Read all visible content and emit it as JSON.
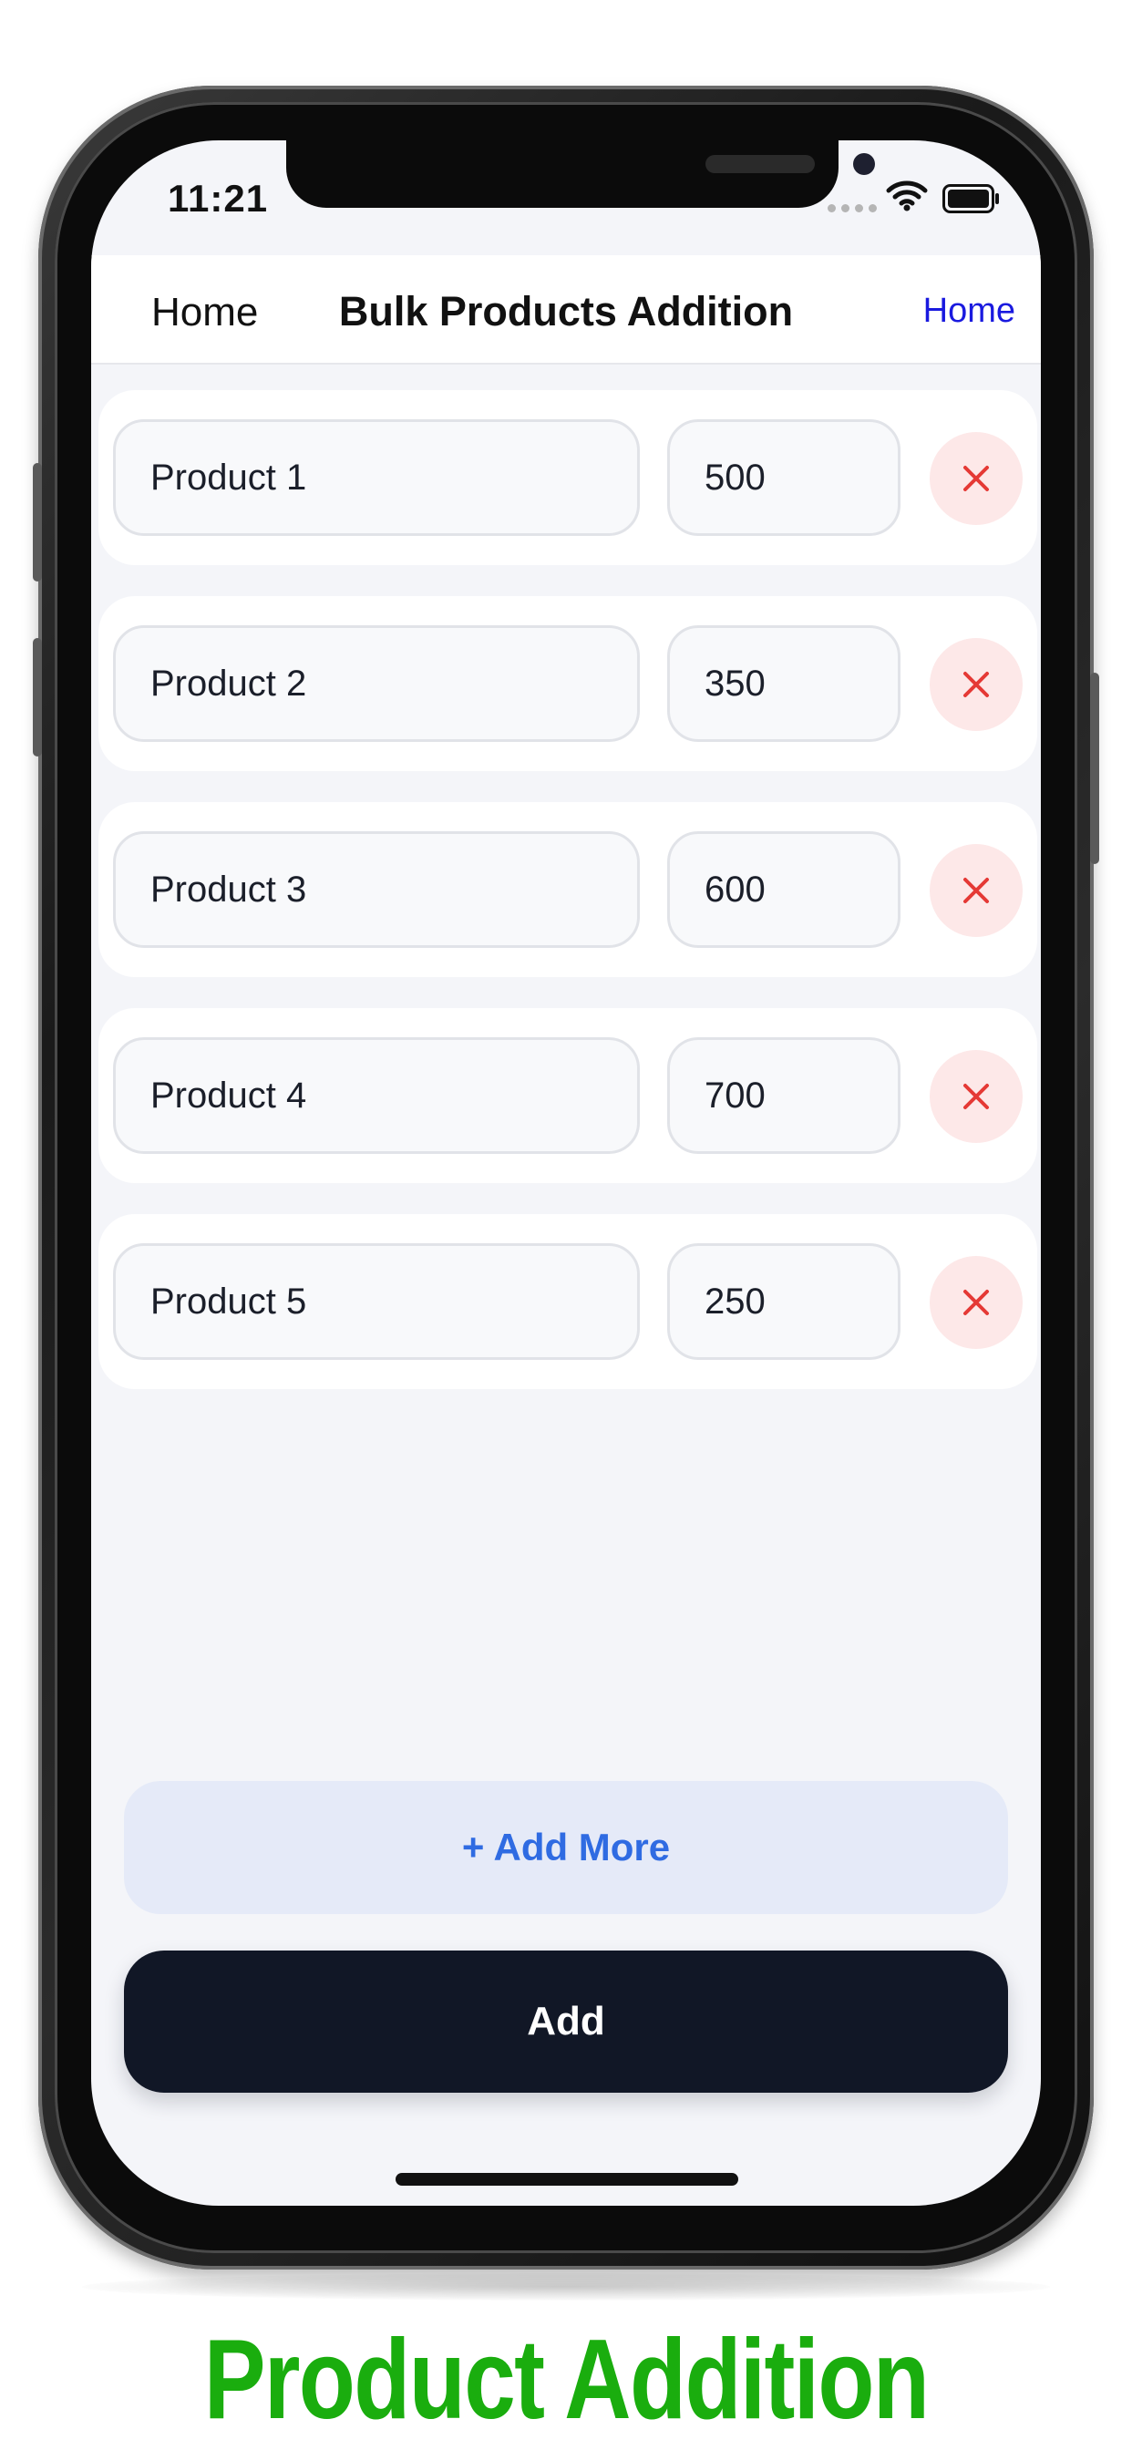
{
  "status_bar": {
    "time": "11:21"
  },
  "navbar": {
    "back_label": "Home",
    "title": "Bulk Products Addition",
    "right_link": "Home"
  },
  "products": [
    {
      "name": "Product 1",
      "quantity": "500"
    },
    {
      "name": "Product 2",
      "quantity": "350"
    },
    {
      "name": "Product 3",
      "quantity": "600"
    },
    {
      "name": "Product 4",
      "quantity": "700"
    },
    {
      "name": "Product 5",
      "quantity": "250"
    }
  ],
  "actions": {
    "add_more_label": "+ Add More",
    "add_label": "Add"
  },
  "caption": "Product Addition",
  "colors": {
    "primary_dark": "#111726",
    "accent_blue": "#2f6be2",
    "delete_red": "#e53935",
    "delete_bg": "#fde8e8",
    "caption_green": "#1aad0e",
    "link_blue": "#1a1adf"
  },
  "icons": {
    "delete": "close-icon",
    "wifi": "wifi-icon",
    "battery": "battery-icon"
  }
}
